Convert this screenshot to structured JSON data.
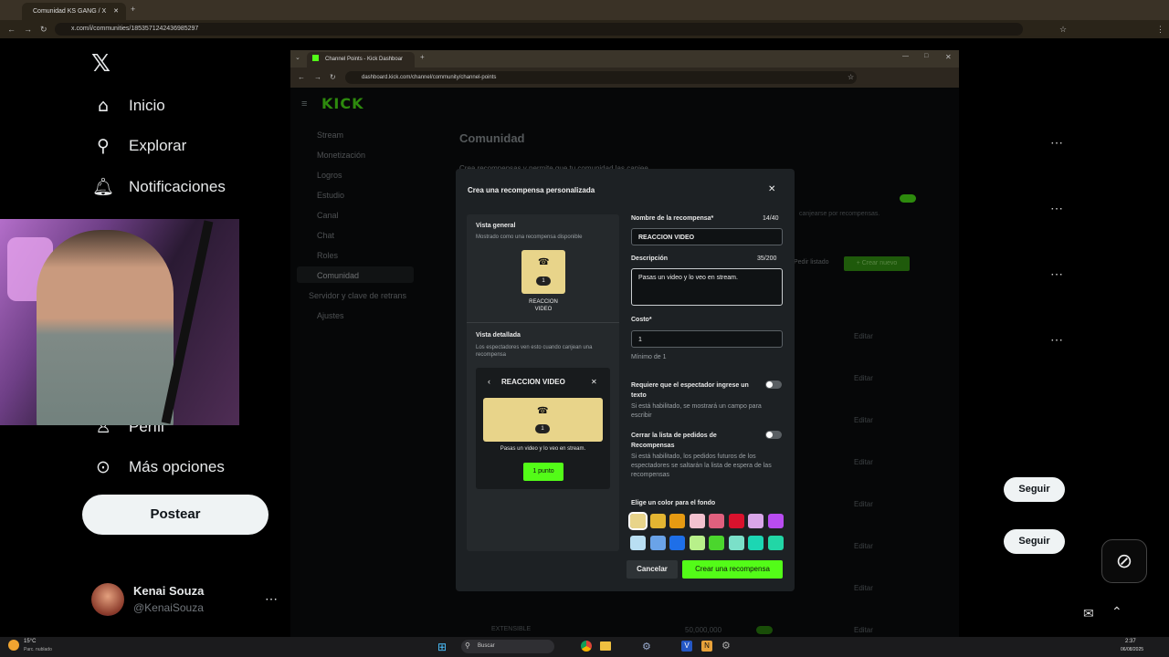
{
  "outer_browser": {
    "tab_title": "Comunidad KS GANG / X",
    "url": "x.com/i/communities/1853571242436985297"
  },
  "x_sidebar": {
    "nav": [
      {
        "label": "Inicio",
        "icon": "home-icon"
      },
      {
        "label": "Explorar",
        "icon": "search-icon"
      },
      {
        "label": "Notificaciones",
        "icon": "bell-icon"
      },
      {
        "label": "Perfil",
        "icon": "person-icon"
      },
      {
        "label": "Más opciones",
        "icon": "more-circle-icon"
      }
    ],
    "post_button": "Postear",
    "user": {
      "name": "Kenai Souza",
      "handle": "@KenaiSouza"
    }
  },
  "x_right": {
    "follow_label": "Seguir"
  },
  "inner_browser": {
    "tab_title": "Channel Points - Kick Dashboar",
    "url": "dashboard.kick.com/channel/community/channel-points"
  },
  "kick": {
    "brand": "KICK",
    "page_title": "Comunidad",
    "sidebar": [
      "Stream",
      "Monetización",
      "Logros",
      "Estudio",
      "Canal",
      "Chat",
      "Roles",
      "Comunidad",
      "Servidor y clave de retrans",
      "Ajustes"
    ],
    "bg_text": {
      "banner": "Crea recompensas y permite que tu comunidad las canjee",
      "canjear": "canjearse por recompensas.",
      "pedir_listado": "Pedir listado",
      "crear_nuevo": "+ Crear nuevo",
      "edit": "Editar",
      "extensible": "EXTENSIBLE",
      "cost": "50,000,000"
    }
  },
  "modal": {
    "title": "Crea una recompensa personalizada",
    "preview_general": {
      "title": "Vista general",
      "subtitle": "Mostrado como una recompensa disponible",
      "cost": "1",
      "name": "REACCION VIDEO"
    },
    "preview_detail": {
      "title": "Vista detallada",
      "subtitle": "Los espectadores ven esto cuando canjean una recompensa",
      "header": "REACCION VIDEO",
      "cost": "1",
      "description": "Pasas un video y lo veo en stream.",
      "button": "1 punto"
    },
    "name_field": {
      "label": "Nombre de la recompensa*",
      "counter": "14/40",
      "value": "REACCION VIDEO"
    },
    "desc_field": {
      "label": "Descripción",
      "counter": "35/200",
      "value": "Pasas un video y lo veo en stream."
    },
    "cost_field": {
      "label": "Costo*",
      "value": "1",
      "hint": "Mínimo de 1"
    },
    "require_text": {
      "label": "Requiere que el espectador ingrese un texto",
      "hint": "Si está habilitado, se mostrará un campo para escribir"
    },
    "close_list": {
      "label": "Cerrar la lista de pedidos de Recompensas",
      "hint": "Si está habilitado, los pedidos futuros de los espectadores se saltarán la lista de espera de las recompensas"
    },
    "color_label": "Elige un color para el fondo",
    "colors": [
      "#e8d48a",
      "#e3b532",
      "#e69a12",
      "#f3c1cf",
      "#e0607e",
      "#d9122d",
      "#d9a6e8",
      "#b84cf0",
      "#b9dff3",
      "#6aa3e8",
      "#1e6fe8",
      "#b8f08a",
      "#4bd62d",
      "#7be0c9",
      "#1cd6b3",
      "#22d6a6"
    ],
    "selected_color": "#e8d48a",
    "cancel": "Cancelar",
    "create": "Crear una recompensa"
  },
  "taskbar": {
    "weather_temp": "15°C",
    "weather_desc": "Parc. nublado",
    "search": "Buscar",
    "time": "2:37",
    "date": "06/08/2025"
  }
}
